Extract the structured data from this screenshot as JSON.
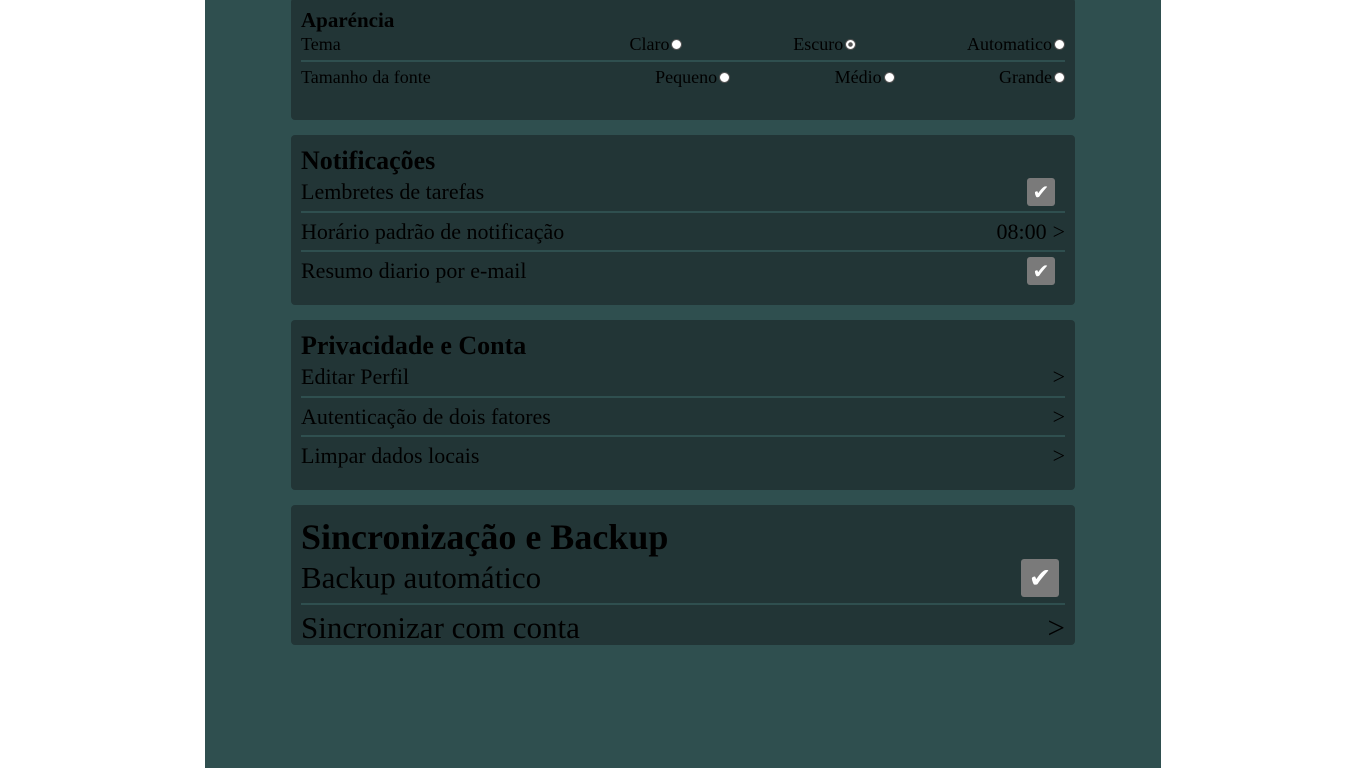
{
  "appearance": {
    "title": "Aparéncia",
    "theme_label": "Tema",
    "theme_options": [
      "Claro",
      "Escuro",
      "Automatico"
    ],
    "theme_selected": "Escuro",
    "font_label": "Tamanho da fonte",
    "font_options": [
      "Pequeno",
      "Médio",
      "Grande"
    ],
    "font_selected": ""
  },
  "notifications": {
    "title": "Notificações",
    "task_reminders_label": "Lembretes de tarefas",
    "task_reminders_checked": true,
    "default_time_label": "Horário padrão de notificação",
    "default_time_value": "08:00",
    "default_time_chevron": ">",
    "daily_summary_label": "Resumo diario por e-mail",
    "daily_summary_checked": true
  },
  "privacy": {
    "title": "Privacidade e Conta",
    "items": [
      {
        "label": "Editar Perfil",
        "chevron": ">"
      },
      {
        "label": "Autenticação de dois fatores",
        "chevron": ">"
      },
      {
        "label": "Limpar dados locais",
        "chevron": ">"
      }
    ]
  },
  "sync": {
    "title": "Sincronização e Backup",
    "auto_backup_label": "Backup automático",
    "auto_backup_checked": true,
    "sync_account_label": "Sincronizar com conta",
    "sync_account_chevron": ">"
  },
  "colors": {
    "page_bg": "#2f4f4f",
    "card_bg": "#223536",
    "checkbox_bg": "#7a7a7a"
  },
  "icons": {
    "checkmark": "checkmark-icon",
    "chevron": "chevron-right-icon"
  }
}
